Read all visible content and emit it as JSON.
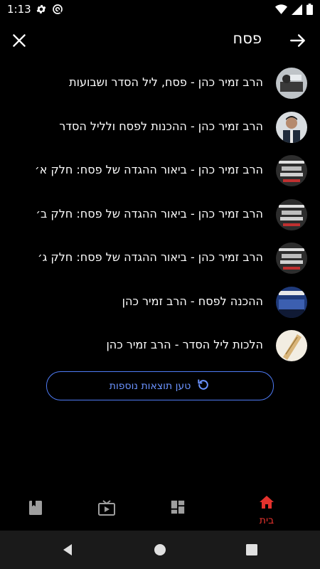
{
  "status": {
    "time": "1:13",
    "icons": [
      "gear-icon",
      "sync-icon",
      "wifi-icon",
      "signal-icon",
      "battery-icon"
    ]
  },
  "app_bar": {
    "title": "פסח",
    "close_icon": "close-icon",
    "back_icon": "arrow-right-icon"
  },
  "results": [
    {
      "title": "הרב זמיר כהן - פסח, ליל הסדר ושבועות",
      "thumb": "photo-rabbi-desk"
    },
    {
      "title": "הרב זמיר כהן - ההכנות לפסח ולליל הסדר",
      "thumb": "photo-rabbi-portrait"
    },
    {
      "title": "הרב זמיר כהן - ביאור ההגדה של פסח: חלק א׳",
      "thumb": "haggadah-cover"
    },
    {
      "title": "הרב זמיר כהן - ביאור ההגדה של פסח: חלק ב׳",
      "thumb": "haggadah-cover"
    },
    {
      "title": "הרב זמיר כהן - ביאור ההגדה של פסח: חלק ג׳",
      "thumb": "haggadah-cover"
    },
    {
      "title": "ההכנה לפסח - הרב זמיר כהן",
      "thumb": "lecture-hall"
    },
    {
      "title": "הלכות ליל הסדר - הרב זמיר כהן",
      "thumb": "matzah-photo"
    }
  ],
  "load_more": {
    "label": "טען תוצאות נוספות",
    "icon": "refresh-icon"
  },
  "bottom_nav": {
    "items": [
      {
        "label": "בית",
        "icon": "home-icon",
        "active": true
      },
      {
        "label": "",
        "icon": "grid-icon",
        "active": false
      },
      {
        "label": "",
        "icon": "tv-icon",
        "active": false
      },
      {
        "label": "",
        "icon": "book-icon",
        "active": false
      }
    ]
  },
  "system_nav": {
    "icons": [
      "back-triangle-icon",
      "home-circle-icon",
      "recents-square-icon"
    ]
  },
  "colors": {
    "accent": "#4f7cf7",
    "active_nav": "#e5322d",
    "background": "#000000"
  }
}
